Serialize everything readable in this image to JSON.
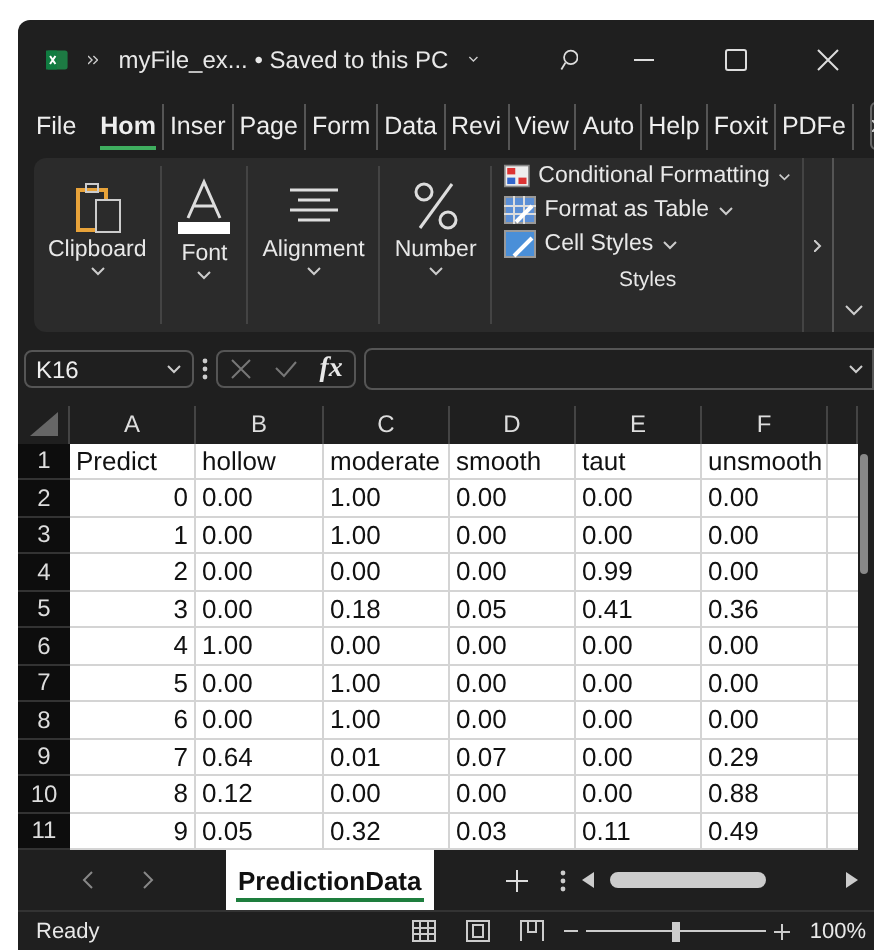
{
  "window": {
    "title": "myFile_ex... • Saved to this PC"
  },
  "tabs": [
    {
      "label": "File",
      "selected": false
    },
    {
      "label": "Hom",
      "selected": true
    },
    {
      "label": "Inser",
      "selected": false
    },
    {
      "label": "Page",
      "selected": false
    },
    {
      "label": "Form",
      "selected": false
    },
    {
      "label": "Data",
      "selected": false
    },
    {
      "label": "Revi",
      "selected": false
    },
    {
      "label": "View",
      "selected": false
    },
    {
      "label": "Auto",
      "selected": false
    },
    {
      "label": "Help",
      "selected": false
    },
    {
      "label": "Foxit",
      "selected": false
    },
    {
      "label": "PDFe",
      "selected": false
    }
  ],
  "ribbon": {
    "groups": [
      {
        "kind": "clipboard",
        "label": "Clipboard"
      },
      {
        "kind": "font",
        "label": "Font"
      },
      {
        "kind": "alignment",
        "label": "Alignment"
      },
      {
        "kind": "number",
        "label": "Number"
      }
    ],
    "styles": {
      "label": "Styles",
      "items": [
        {
          "kind": "conditional",
          "label": "Conditional Formatting"
        },
        {
          "kind": "table",
          "label": "Format as Table"
        },
        {
          "kind": "cellstyles",
          "label": "Cell Styles"
        }
      ]
    }
  },
  "formula_bar": {
    "name_box": "K16",
    "fx": "fx"
  },
  "table": {
    "columns": [
      "A",
      "B",
      "C",
      "D",
      "E",
      "F"
    ],
    "rows": [
      {
        "number": "1",
        "cells": [
          "Predict",
          "hollow",
          "moderate",
          "smooth",
          "taut",
          "unsmooth"
        ]
      },
      {
        "number": "2",
        "cells": [
          "0",
          "0.00",
          "1.00",
          "0.00",
          "0.00",
          "0.00"
        ]
      },
      {
        "number": "3",
        "cells": [
          "1",
          "0.00",
          "1.00",
          "0.00",
          "0.00",
          "0.00"
        ]
      },
      {
        "number": "4",
        "cells": [
          "2",
          "0.00",
          "0.00",
          "0.00",
          "0.99",
          "0.00"
        ]
      },
      {
        "number": "5",
        "cells": [
          "3",
          "0.00",
          "0.18",
          "0.05",
          "0.41",
          "0.36"
        ]
      },
      {
        "number": "6",
        "cells": [
          "4",
          "1.00",
          "0.00",
          "0.00",
          "0.00",
          "0.00"
        ]
      },
      {
        "number": "7",
        "cells": [
          "5",
          "0.00",
          "1.00",
          "0.00",
          "0.00",
          "0.00"
        ]
      },
      {
        "number": "8",
        "cells": [
          "6",
          "0.00",
          "1.00",
          "0.00",
          "0.00",
          "0.00"
        ]
      },
      {
        "number": "9",
        "cells": [
          "7",
          "0.64",
          "0.01",
          "0.07",
          "0.00",
          "0.29"
        ]
      },
      {
        "number": "10",
        "cells": [
          "8",
          "0.12",
          "0.00",
          "0.00",
          "0.00",
          "0.88"
        ]
      },
      {
        "number": "11",
        "cells": [
          "9",
          "0.05",
          "0.32",
          "0.03",
          "0.11",
          "0.49"
        ]
      }
    ]
  },
  "sheet_tabs": [
    {
      "label": "PredictionData",
      "selected": true
    }
  ],
  "status_bar": {
    "text": "Ready",
    "zoom": "100%",
    "zoom_slider": {
      "level": 0.5
    }
  }
}
